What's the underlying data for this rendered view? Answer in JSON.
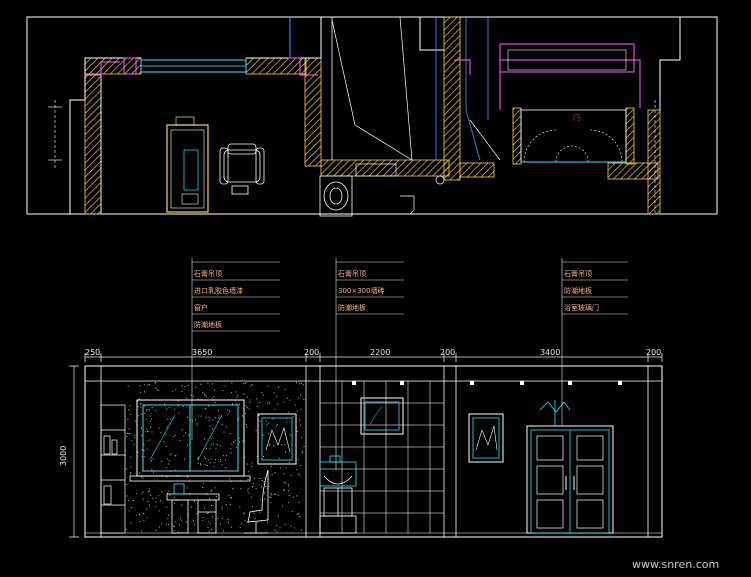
{
  "drawing": {
    "background": "#000000",
    "colors": {
      "wall": "#ffffff",
      "hatch": "#ffd24a",
      "cyan": "#38e0ff",
      "blue": "#5a8cff",
      "magenta": "#ff60ff",
      "annotation": "#ffb080",
      "dimension": "#e8e8e8"
    }
  },
  "elevation": {
    "dimensions_top": [
      "250",
      "3650",
      "200",
      "2200",
      "200",
      "3400",
      "200"
    ],
    "height_dimension": "3000"
  },
  "callouts": {
    "left": [
      "石膏吊顶",
      "进口乳胶色墙漆",
      "窗户",
      "防潮地板"
    ],
    "middle": [
      "石膏吊顶",
      "300×300墙砖",
      "防潮地板"
    ],
    "right": [
      "石膏吊顶",
      "防潮地板",
      "浴室玻璃门"
    ]
  },
  "plan": {
    "door_mark": "门"
  },
  "watermark": "www.snren.com"
}
